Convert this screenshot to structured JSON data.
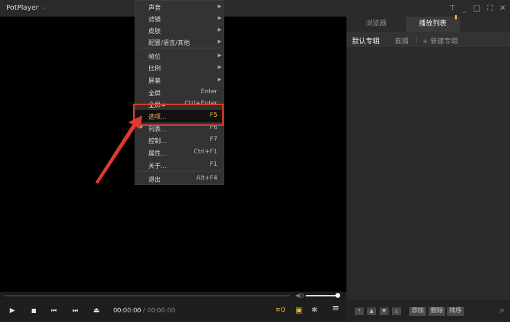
{
  "window": {
    "title": "PotPlayer",
    "title_chevron": "⌵",
    "pin_icon": "⊤",
    "minimize_icon": "_",
    "maximize_icon": "□",
    "fullscreen_icon": "⛶",
    "close_icon": "✕"
  },
  "context_menu": {
    "items": [
      {
        "label": "声音",
        "shortcut": "",
        "submenu": true
      },
      {
        "label": "滤镜",
        "shortcut": "",
        "submenu": true
      },
      {
        "label": "皮肤",
        "shortcut": "",
        "submenu": true
      },
      {
        "label": "配置/语言/其他",
        "shortcut": "",
        "submenu": true
      },
      {
        "label": "帧位",
        "shortcut": "",
        "submenu": true
      },
      {
        "label": "比例",
        "shortcut": "",
        "submenu": true
      },
      {
        "label": "屏幕",
        "shortcut": "",
        "submenu": true
      },
      {
        "label": "全屏",
        "shortcut": "Enter",
        "submenu": false
      },
      {
        "label": "全屏+",
        "shortcut": "Ctrl+Enter",
        "submenu": false
      },
      {
        "label": "选项...",
        "shortcut": "F5",
        "submenu": false
      },
      {
        "label": "列表...",
        "shortcut": "F6",
        "submenu": false
      },
      {
        "label": "控制...",
        "shortcut": "F7",
        "submenu": false
      },
      {
        "label": "属性...",
        "shortcut": "Ctrl+F1",
        "submenu": false
      },
      {
        "label": "关于...",
        "shortcut": "F1",
        "submenu": false
      },
      {
        "label": "退出",
        "shortcut": "Alt+F4",
        "submenu": false
      }
    ],
    "selected": "选项...",
    "checked": "列表...",
    "submenu_arrow": "▶",
    "check_mark": "✔"
  },
  "player": {
    "current_time": "00:00:00",
    "separator": " / ",
    "duration": "00:00:00",
    "volume_level": 1.0,
    "seek_progress": 0.0,
    "icons": {
      "play": "▶",
      "stop": "■",
      "prev": "⏮",
      "next": "⏭",
      "eject": "⏏",
      "playlist_search": "≡Q",
      "chapter": "▣",
      "settings": "✱",
      "menu": "≡",
      "volume": "◀))"
    }
  },
  "panel": {
    "tabs": [
      {
        "label": "浏览器",
        "active": false
      },
      {
        "label": "播放列表",
        "active": true
      }
    ],
    "subtabs": {
      "default_album": "默认专辑",
      "live": "直播",
      "new_album": "+ 新建专辑"
    },
    "bottom_buttons": {
      "move_top_icon": "⤒",
      "move_up_icon": "▲",
      "move_down_icon": "▼",
      "move_bottom_icon": "⤓",
      "add": "添加",
      "delete": "删除",
      "sort": "排序"
    },
    "search_icon": "⌕"
  },
  "colors": {
    "highlight_box": "#e03a2f",
    "accent_yellow": "#e8b43a",
    "background": "#000000"
  }
}
